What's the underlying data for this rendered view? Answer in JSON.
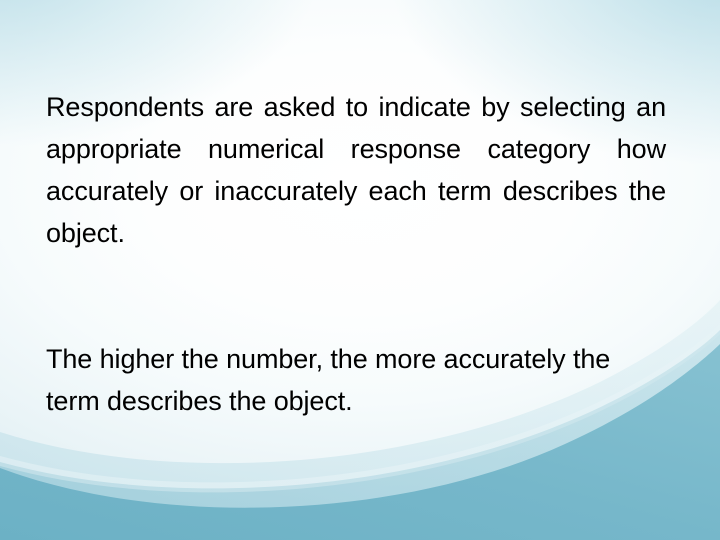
{
  "slide": {
    "theme_name": "flow-curve-background",
    "background": {
      "center_color": "#ffffff",
      "edge_tint_color": "#c6e1ea",
      "corner_tint_color": "#96cddc",
      "band_light_color": "#bedfe8",
      "band_mid_color": "#a3d0dd",
      "band_dark_color": "#6fb3c7"
    },
    "text_color": "#000000",
    "body": {
      "paragraphs": [
        {
          "id": "paragraph-1",
          "align": "justify",
          "text": "Respondents are asked to indicate by selecting an appropriate numerical response category how accurately or inaccurately each term describes the object.",
          "lines": [
            "Respondents are asked to indicate by",
            "selecting an appropriate numerical",
            "response category how accurately or",
            "inaccurately each term describes the object."
          ]
        },
        {
          "id": "paragraph-2",
          "align": "left",
          "text": "The higher the number, the more accurately the term describes the object.",
          "lines": [
            "The higher the number, the more accurately",
            "the term describes the object."
          ]
        }
      ]
    }
  }
}
